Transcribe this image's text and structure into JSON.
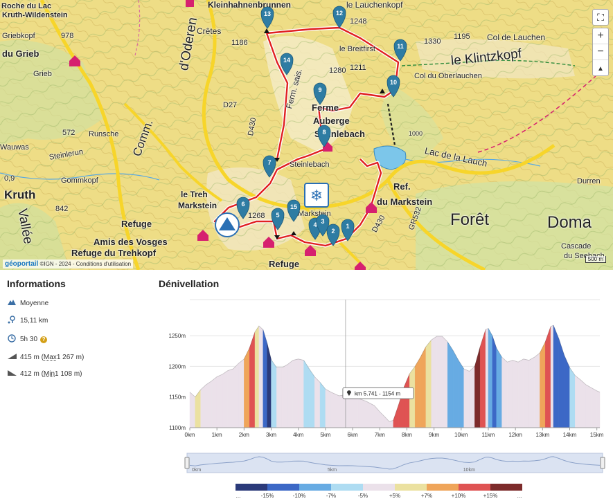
{
  "map": {
    "labels": [
      {
        "text": "Roche du Lac",
        "cls": "b",
        "fs": 11
      },
      {
        "text": "Kruth-Wildenstein",
        "cls": "b",
        "fs": 11
      },
      {
        "text": "Griebkopf",
        "cls": "",
        "fs": 11
      },
      {
        "text": "978",
        "cls": "",
        "fs": 11
      },
      {
        "text": "du Grieb",
        "cls": "b",
        "fs": 13
      },
      {
        "text": "Grieb",
        "cls": "",
        "fs": 11
      },
      {
        "text": "Crêtes",
        "cls": "",
        "fs": 12
      },
      {
        "text": "1186",
        "cls": "",
        "fs": 11
      },
      {
        "text": "Kleinhahnenbrunnen",
        "cls": "b",
        "fs": 12
      },
      {
        "text": "le Lauchenkopf",
        "cls": "",
        "fs": 12
      },
      {
        "text": "1248",
        "cls": "",
        "fs": 11
      },
      {
        "text": "1195",
        "cls": "",
        "fs": 11
      },
      {
        "text": "Col de Lauchen",
        "cls": "",
        "fs": 12
      },
      {
        "text": "1330",
        "cls": "",
        "fs": 11
      },
      {
        "text": "le Klintzkopf",
        "cls": "",
        "fs": 19
      },
      {
        "text": "le Breitfirst",
        "cls": "",
        "fs": 11
      },
      {
        "text": "1280",
        "cls": "",
        "fs": 11
      },
      {
        "text": "1211",
        "cls": "",
        "fs": 11
      },
      {
        "text": "Col du Oberlauchen",
        "cls": "",
        "fs": 11
      },
      {
        "text": "d'Oderen",
        "cls": "",
        "fs": 19
      },
      {
        "text": "D27",
        "cls": "",
        "fs": 11
      },
      {
        "text": "Ferme",
        "cls": "b",
        "fs": 13
      },
      {
        "text": "Auberge",
        "cls": "b",
        "fs": 13
      },
      {
        "text": "Steinlebach",
        "cls": "b",
        "fs": 13
      },
      {
        "text": "572",
        "cls": "",
        "fs": 11
      },
      {
        "text": "Runsche",
        "cls": "",
        "fs": 11
      },
      {
        "text": "Wauwas",
        "cls": "",
        "fs": 11
      },
      {
        "text": "Steinlerun",
        "cls": "",
        "fs": 11
      },
      {
        "text": "Comm.",
        "cls": "",
        "fs": 17
      },
      {
        "text": "D430",
        "cls": "",
        "fs": 11
      },
      {
        "text": "Ferm. sais.",
        "cls": "",
        "fs": 12
      },
      {
        "text": "Steinlebach",
        "cls": "",
        "fs": 11
      },
      {
        "text": "Lac de la Lauch",
        "cls": "",
        "fs": 13
      },
      {
        "text": "0,9",
        "cls": "",
        "fs": 11
      },
      {
        "text": "Kruth",
        "cls": "b",
        "fs": 17
      },
      {
        "text": "Gommkopf",
        "cls": "",
        "fs": 11
      },
      {
        "text": "842",
        "cls": "",
        "fs": 11
      },
      {
        "text": "le Treh",
        "cls": "b",
        "fs": 12
      },
      {
        "text": "Markstein",
        "cls": "b",
        "fs": 12
      },
      {
        "text": "Refuge",
        "cls": "b",
        "fs": 13
      },
      {
        "text": "Amis des Vosges",
        "cls": "b",
        "fs": 13
      },
      {
        "text": "Refuge du Trehkopf",
        "cls": "b",
        "fs": 13
      },
      {
        "text": "Refuge",
        "cls": "b",
        "fs": 13
      },
      {
        "text": "Markstein",
        "cls": "",
        "fs": 11
      },
      {
        "text": "Ref.",
        "cls": "b",
        "fs": 13
      },
      {
        "text": "du Markstein",
        "cls": "b",
        "fs": 13
      },
      {
        "text": "D430",
        "cls": "",
        "fs": 11
      },
      {
        "text": "Forêt",
        "cls": "",
        "fs": 24
      },
      {
        "text": "Doma",
        "cls": "",
        "fs": 24
      },
      {
        "text": "Durren",
        "cls": "",
        "fs": 11
      },
      {
        "text": "Cascade",
        "cls": "",
        "fs": 11
      },
      {
        "text": "du Seebach",
        "cls": "",
        "fs": 11
      },
      {
        "text": "GR532",
        "cls": "",
        "fs": 11
      },
      {
        "text": "Vallée",
        "cls": "",
        "fs": 19
      },
      {
        "text": "1000",
        "cls": "",
        "fs": 9
      },
      {
        "text": "1268",
        "cls": "",
        "fs": 11
      }
    ],
    "waypoints": [
      "13",
      "12",
      "11",
      "14",
      "10",
      "9",
      "8",
      "7",
      "6",
      "15",
      "5",
      "4",
      "3",
      "2",
      "1"
    ],
    "attribution": {
      "brand": "géoportail",
      "text": "©IGN - 2024 - Conditions d'utilisation"
    },
    "scale": "500 m",
    "zoom_in": "+",
    "zoom_out": "−",
    "compass": "▲",
    "fullscreen": "⛶"
  },
  "info": {
    "title": "Informations",
    "difficulty": "Moyenne",
    "distance": "15,11 km",
    "duration": "5h 30",
    "duration_badge": "?",
    "ascent_prefix": "415 m (",
    "ascent_max_label": "Max",
    "ascent_max_value": " 1 267 m)",
    "descent_prefix": "412 m (",
    "descent_min_label": "Min",
    "descent_min_value": " 1 108 m)"
  },
  "colors": {
    "trail": "#e02020",
    "marker": "#2e7ca3",
    "pink": "#d6206f"
  },
  "chart_data": {
    "type": "area",
    "title": "Dénivellation",
    "xlabel": "",
    "ylabel": "",
    "x_unit": "km",
    "y_unit": "m",
    "xlim": [
      0,
      15.11
    ],
    "ylim": [
      1100,
      1275
    ],
    "y_ticks": [
      "1100m",
      "1150m",
      "1200m",
      "1250m"
    ],
    "x_ticks": [
      "0km",
      "1km",
      "2km",
      "3km",
      "4km",
      "5km",
      "6km",
      "7km",
      "8km",
      "9km",
      "10km",
      "11km",
      "12km",
      "13km",
      "14km",
      "15km"
    ],
    "grid": true,
    "profile": [
      [
        0.0,
        1158
      ],
      [
        0.2,
        1150
      ],
      [
        0.4,
        1162
      ],
      [
        0.6,
        1170
      ],
      [
        0.8,
        1176
      ],
      [
        1.0,
        1183
      ],
      [
        1.2,
        1187
      ],
      [
        1.4,
        1193
      ],
      [
        1.6,
        1196
      ],
      [
        1.8,
        1205
      ],
      [
        2.0,
        1212
      ],
      [
        2.2,
        1230
      ],
      [
        2.4,
        1256
      ],
      [
        2.55,
        1266
      ],
      [
        2.7,
        1260
      ],
      [
        2.85,
        1238
      ],
      [
        3.0,
        1211
      ],
      [
        3.2,
        1198
      ],
      [
        3.4,
        1198
      ],
      [
        3.6,
        1203
      ],
      [
        3.8,
        1210
      ],
      [
        4.0,
        1212
      ],
      [
        4.2,
        1210
      ],
      [
        4.4,
        1196
      ],
      [
        4.6,
        1183
      ],
      [
        4.8,
        1174
      ],
      [
        5.0,
        1163
      ],
      [
        5.2,
        1158
      ],
      [
        5.5,
        1152
      ],
      [
        5.8,
        1154
      ],
      [
        6.0,
        1152
      ],
      [
        6.2,
        1148
      ],
      [
        6.5,
        1143
      ],
      [
        6.8,
        1136
      ],
      [
        7.0,
        1126
      ],
      [
        7.2,
        1117
      ],
      [
        7.35,
        1110
      ],
      [
        7.5,
        1112
      ],
      [
        7.7,
        1138
      ],
      [
        7.9,
        1167
      ],
      [
        8.1,
        1188
      ],
      [
        8.3,
        1200
      ],
      [
        8.5,
        1215
      ],
      [
        8.7,
        1232
      ],
      [
        8.9,
        1243
      ],
      [
        9.1,
        1249
      ],
      [
        9.3,
        1249
      ],
      [
        9.5,
        1240
      ],
      [
        9.7,
        1226
      ],
      [
        9.9,
        1210
      ],
      [
        10.1,
        1196
      ],
      [
        10.3,
        1192
      ],
      [
        10.5,
        1200
      ],
      [
        10.7,
        1232
      ],
      [
        10.9,
        1260
      ],
      [
        11.0,
        1262
      ],
      [
        11.15,
        1250
      ],
      [
        11.3,
        1230
      ],
      [
        11.5,
        1215
      ],
      [
        11.7,
        1207
      ],
      [
        11.9,
        1210
      ],
      [
        12.1,
        1207
      ],
      [
        12.3,
        1212
      ],
      [
        12.5,
        1210
      ],
      [
        12.7,
        1215
      ],
      [
        12.9,
        1222
      ],
      [
        13.1,
        1240
      ],
      [
        13.3,
        1265
      ],
      [
        13.4,
        1267
      ],
      [
        13.6,
        1245
      ],
      [
        13.8,
        1218
      ],
      [
        14.0,
        1198
      ],
      [
        14.2,
        1185
      ],
      [
        14.4,
        1178
      ],
      [
        14.6,
        1170
      ],
      [
        14.8,
        1165
      ],
      [
        15.0,
        1160
      ],
      [
        15.11,
        1158
      ]
    ],
    "tooltip": {
      "text": "km 5.741 - 1154 m",
      "x": 5.741,
      "y": 1154
    },
    "slope_legend": [
      {
        "label": "...",
        "color": "#2b3a7a"
      },
      {
        "label": "-15%",
        "color": "#3c68c6"
      },
      {
        "label": "-10%",
        "color": "#67abe3"
      },
      {
        "label": "-7%",
        "color": "#aedcf2"
      },
      {
        "label": "-5%",
        "color": "#ebe1ea"
      },
      {
        "label": "+5%",
        "color": "#ebe1a0"
      },
      {
        "label": "+7%",
        "color": "#efa55a"
      },
      {
        "label": "+10%",
        "color": "#df5353"
      },
      {
        "label": "+15%",
        "color": "#7d2b2b"
      },
      {
        "label": "...",
        "color": ""
      }
    ],
    "navigator_ticks": [
      "0km",
      "5km",
      "10km"
    ]
  }
}
